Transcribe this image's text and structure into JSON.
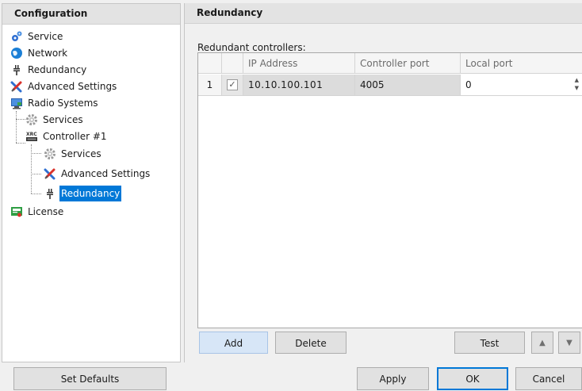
{
  "left": {
    "header": "Configuration",
    "tree": {
      "service": "Service",
      "network": "Network",
      "redundancy": "Redundancy",
      "advanced_settings": "Advanced Settings",
      "radio_systems": "Radio Systems",
      "services": "Services",
      "controller": "Controller #1",
      "controller_services": "Services",
      "controller_advanced": "Advanced Settings",
      "controller_redundancy": "Redundancy",
      "license": "License"
    }
  },
  "right": {
    "header": "Redundancy",
    "grid_label": "Redundant controllers:",
    "columns": [
      "",
      "",
      "IP Address",
      "Controller port",
      "Local port"
    ],
    "rows": [
      {
        "num": "1",
        "checked": "✓",
        "ip": "10.10.100.101",
        "controller_port": "4005",
        "local_port": "0"
      }
    ],
    "buttons": {
      "add": "Add",
      "delete": "Delete",
      "test": "Test",
      "up": "▲",
      "down": "▼"
    }
  },
  "footer": {
    "set_defaults": "Set Defaults",
    "apply": "Apply",
    "ok": "OK",
    "cancel": "Cancel"
  },
  "colors": {
    "selection": "#0078d7",
    "header_bg": "#e3e3e3"
  }
}
